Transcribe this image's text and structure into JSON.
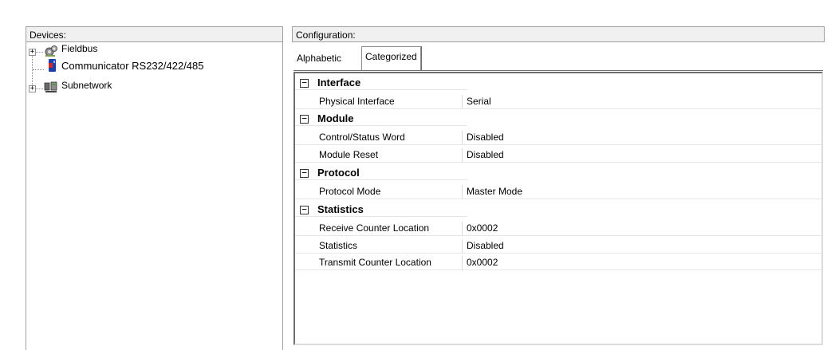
{
  "devices_panel": {
    "header": "Devices:",
    "tree": [
      {
        "label": "Fieldbus",
        "icon": "fieldbus-gear-icon",
        "expandable": true,
        "expander": "+"
      },
      {
        "label": "Communicator RS232/422/485",
        "icon": "communicator-device-icon",
        "expandable": false
      },
      {
        "label": "Subnetwork",
        "icon": "subnetwork-icon",
        "expandable": true,
        "expander": "+"
      }
    ]
  },
  "config_panel": {
    "header": "Configuration:",
    "tabs": [
      {
        "label": "Alphabetic",
        "active": false
      },
      {
        "label": "Categorized",
        "active": true
      }
    ],
    "categories": [
      {
        "toggle": "−",
        "label": "Interface",
        "properties": [
          {
            "name": "Physical Interface",
            "value": "Serial"
          }
        ]
      },
      {
        "toggle": "−",
        "label": "Module",
        "properties": [
          {
            "name": "Control/Status Word",
            "value": "Disabled"
          },
          {
            "name": "Module Reset",
            "value": "Disabled"
          }
        ]
      },
      {
        "toggle": "−",
        "label": "Protocol",
        "properties": [
          {
            "name": "Protocol Mode",
            "value": "Master Mode"
          }
        ]
      },
      {
        "toggle": "−",
        "label": "Statistics",
        "properties": [
          {
            "name": "Receive Counter Location",
            "value": "0x0002"
          },
          {
            "name": "Statistics",
            "value": "Disabled"
          },
          {
            "name": "Transmit Counter Location",
            "value": "0x0002"
          }
        ]
      }
    ]
  },
  "colors": {
    "header_bg": "#f0f0f0",
    "border": "#a0a0a0",
    "grid_line": "#e6e6e6"
  }
}
